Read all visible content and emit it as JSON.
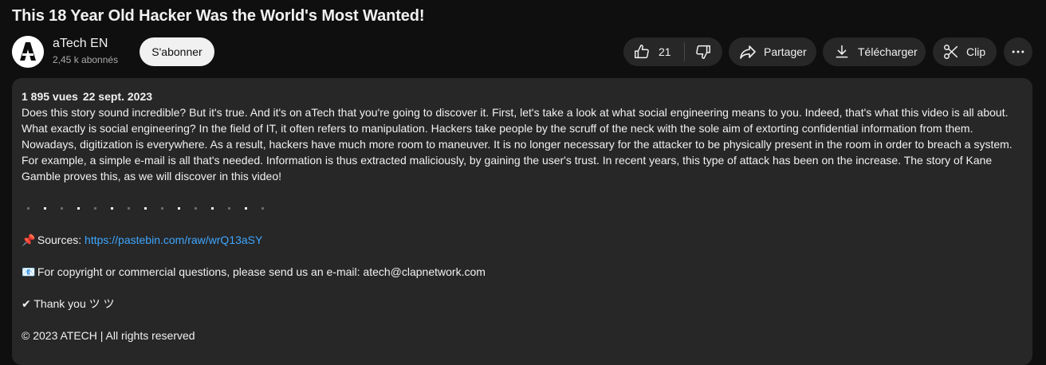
{
  "video": {
    "title": "This 18 Year Old Hacker Was the World's Most Wanted!"
  },
  "channel": {
    "name": "aTech EN",
    "subscribers": "2,45 k abonnés",
    "subscribe_label": "S'abonner"
  },
  "actions": {
    "like_count": "21",
    "share_label": "Partager",
    "download_label": "Télécharger",
    "clip_label": "Clip"
  },
  "description": {
    "views": "1 895 vues",
    "date": "22 sept. 2023",
    "body": "Does this story sound incredible? But it's true. And it's on aTech that you're going to discover it. First, let's take a look at what social engineering means to you. Indeed, that's what this video is all about. What exactly is social engineering? In the field of IT, it often refers to manipulation. Hackers take people by the scruff of the neck with the sole aim of extorting confidential information from them. Nowadays, digitization is everywhere. As a result, hackers have much more room to maneuver. It is no longer necessary for the attacker to be physically present in the room in order to breach a system. For example, a simple e-mail is all that's needed. Information is thus extracted maliciously, by gaining the user's trust. In recent years, this type of attack has been on the increase. The story of Kane Gamble proves this, as we will discover in this video!",
    "sources_emoji": "📌",
    "sources_label": "Sources:",
    "sources_link": "https://pastebin.com/raw/wrQ13aSY",
    "contact_emoji": "📧",
    "contact_text": "For copyright or commercial questions, please send us an e-mail: atech@clapnetwork.com",
    "thanks_text": "✔ Thank you ツ ツ",
    "copyright": "© 2023 ATECH | All rights reserved"
  },
  "colors": {
    "background": "#0f0f0f",
    "surface": "#272727",
    "text": "#f1f1f1",
    "secondary_text": "#aaaaaa",
    "link": "#3ea6ff"
  }
}
